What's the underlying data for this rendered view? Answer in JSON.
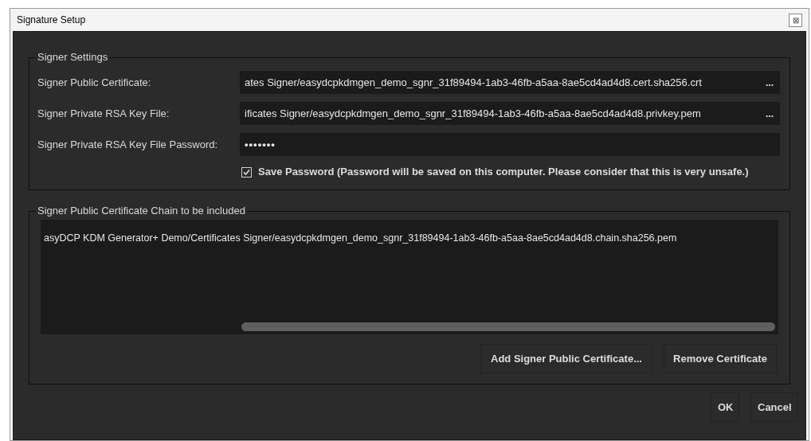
{
  "window": {
    "title": "Signature Setup",
    "close": "⊠"
  },
  "signer_settings": {
    "legend": "Signer Settings",
    "fields": [
      {
        "kind": "file",
        "label": "Signer Public Certificate:",
        "value": "ates Signer/easydcpkdmgen_demo_sgnr_31f89494-1ab3-46fb-a5aa-8ae5cd4ad4d8.cert.sha256.crt",
        "browse": "..."
      },
      {
        "kind": "file",
        "label": "Signer Private RSA Key File:",
        "value": "ificates Signer/easydcpkdmgen_demo_sgnr_31f89494-1ab3-46fb-a5aa-8ae5cd4ad4d8.privkey.pem",
        "browse": "..."
      },
      {
        "kind": "password",
        "label": "Signer Private RSA Key File Password:",
        "value": "•••••••"
      }
    ],
    "save_password": {
      "label": "Save Password (Password will be saved on this computer. Please consider that this is very unsafe.)",
      "checked": true
    }
  },
  "chain": {
    "legend": "Signer Public Certificate Chain to be included",
    "items": [
      {
        "text": "asyDCP KDM Generator+ Demo/Certificates Signer/easydcpkdmgen_demo_sgnr_31f89494-1ab3-46fb-a5aa-8ae5cd4ad4d8.chain.sha256.pem",
        "selected": false
      }
    ],
    "buttons": [
      "Add Signer Public Certificate...",
      "Remove Certificate"
    ]
  },
  "buttons": [
    "OK",
    "Cancel"
  ]
}
